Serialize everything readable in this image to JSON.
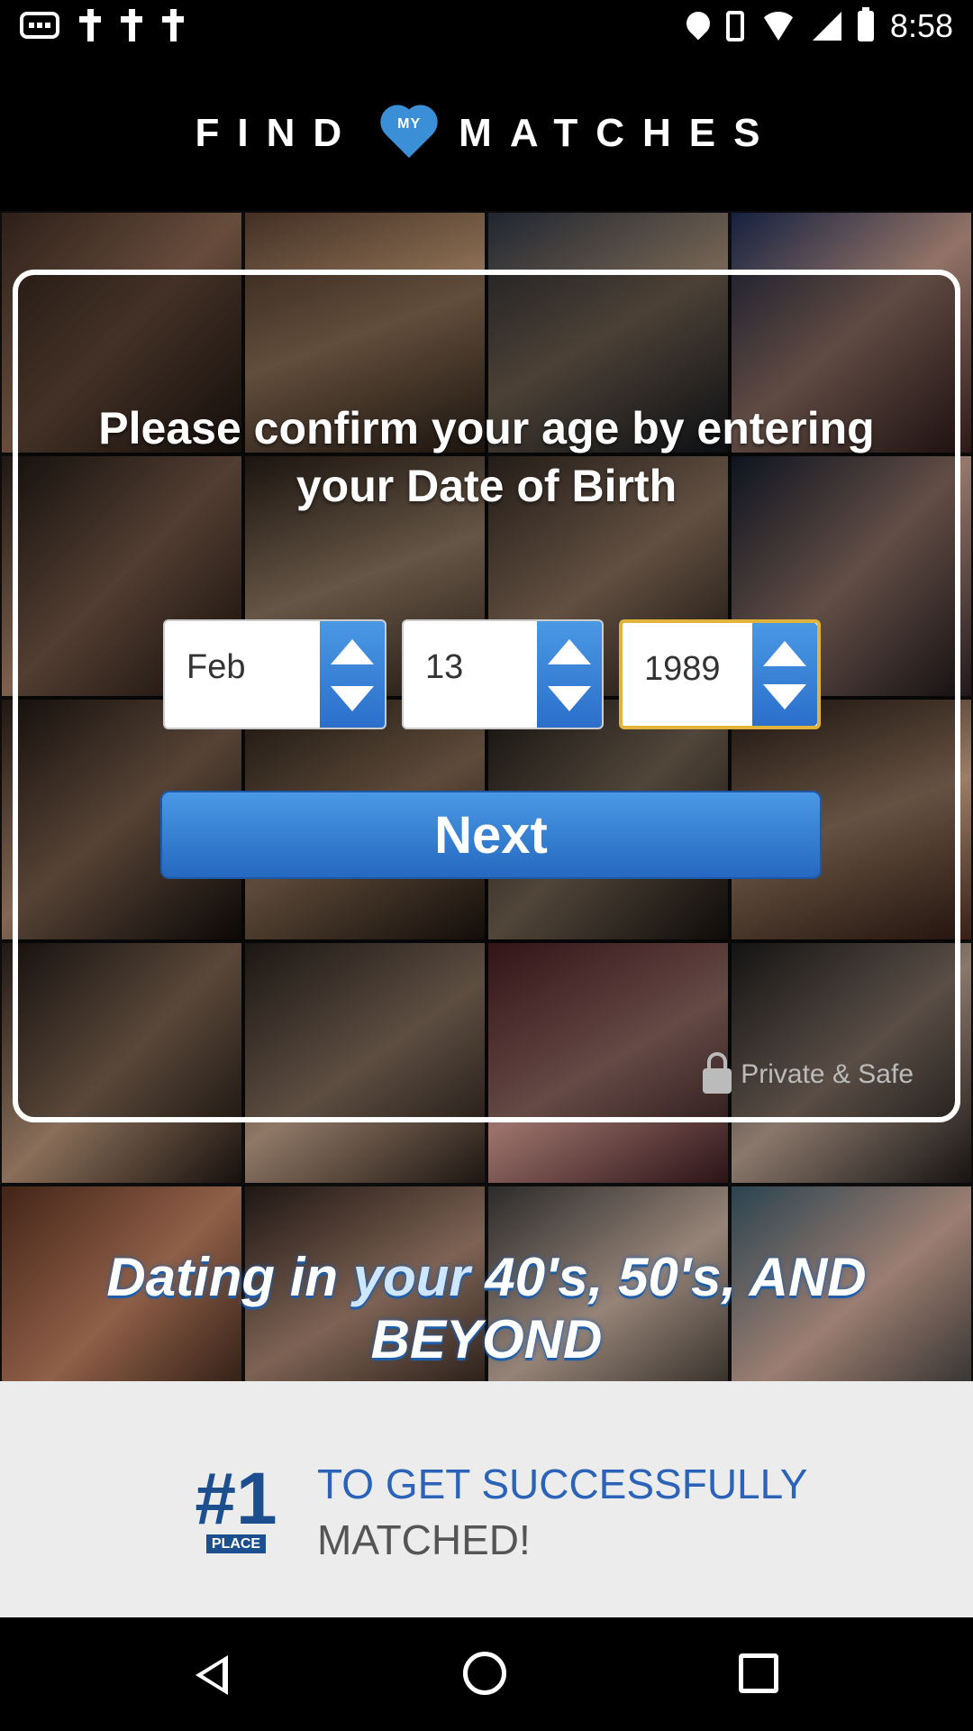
{
  "status_bar": {
    "time": "8:58"
  },
  "header": {
    "logo_left": "FIND",
    "logo_heart": "MY",
    "logo_right": "MATCHES"
  },
  "dialog": {
    "prompt": "Please confirm your age by entering your Date of Birth",
    "month": "Feb",
    "day": "13",
    "year": "1989",
    "next_label": "Next",
    "secure_label": "Private & Safe"
  },
  "tagline": {
    "part1": "Dating in ",
    "part2": "your",
    "part3": " 40's, 50's, AND BEYOND"
  },
  "banner": {
    "badge_number": "#1",
    "badge_place": "PLACE",
    "line1": "TO GET SUCCESSFULLY",
    "line2": "MATCHED!"
  },
  "colors": {
    "accent_blue": "#3a8fd6",
    "button_blue": "#2b6fcb",
    "selected_border": "#e2b33a"
  },
  "icons": [
    "message-icon",
    "cross-icon",
    "cross-icon",
    "cross-icon",
    "location-icon",
    "vibrate-icon",
    "wifi-icon",
    "signal-icon",
    "battery-icon",
    "lock-icon",
    "nav-back-icon",
    "nav-home-icon",
    "nav-recents-icon"
  ]
}
